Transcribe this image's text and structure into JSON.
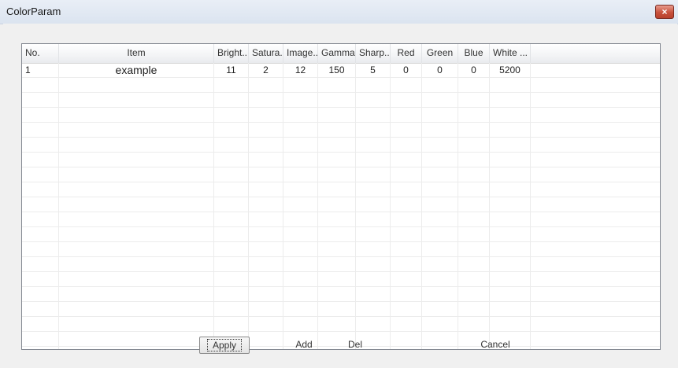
{
  "window": {
    "title": "ColorParam",
    "close_label": "×"
  },
  "table": {
    "columns": [
      "No.",
      "Item",
      "Bright...",
      "Satura...",
      "Image...",
      "Gamma",
      "Sharp...",
      "Red",
      "Green",
      "Blue",
      "White ..."
    ],
    "rows": [
      [
        "1",
        "example",
        "11",
        "2",
        "12",
        "150",
        "5",
        "0",
        "0",
        "0",
        "5200"
      ]
    ]
  },
  "buttons": {
    "apply": "Apply",
    "add": "Add",
    "del": "Del",
    "cancel": "Cancel"
  }
}
